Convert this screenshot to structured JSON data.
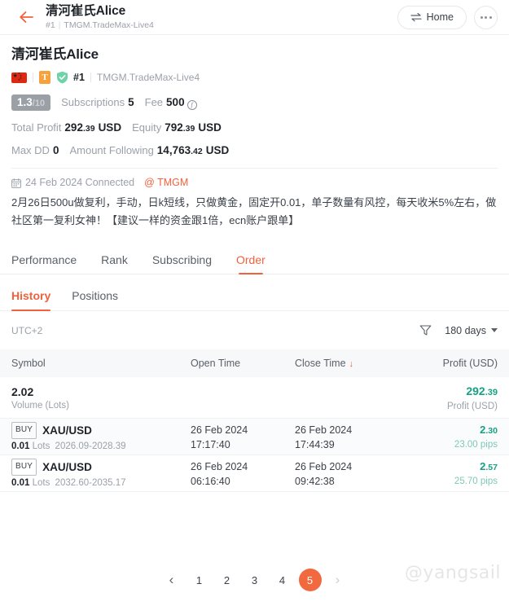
{
  "topbar": {
    "back_icon": "arrow-left-icon",
    "title": "清河崔氏Alice",
    "rank": "#1",
    "separator": "|",
    "account": "TMGM.TradeMax-Live4",
    "home_label": "Home",
    "home_icon": "swap-arrows-icon",
    "more_icon": "ellipsis-icon"
  },
  "profile": {
    "name": "清河崔氏Alice",
    "flag_icon": "china-flag-icon",
    "type_badge": "T",
    "verified_icon": "shield-check-icon",
    "rank": "#1",
    "account": "TMGM.TradeMax-Live4"
  },
  "stats": {
    "score": "1.3",
    "score_denom": "/10",
    "subscriptions_label": "Subscriptions",
    "subscriptions_value": "5",
    "fee_label": "Fee",
    "fee_value": "500",
    "fee_icon": "coin-icon",
    "total_profit_label": "Total Profit",
    "total_profit_int": "292",
    "total_profit_dec": ".39",
    "total_profit_currency": "USD",
    "equity_label": "Equity",
    "equity_int": "792",
    "equity_dec": ".39",
    "equity_currency": "USD",
    "max_dd_label": "Max DD",
    "max_dd_value": "0",
    "amount_following_label": "Amount Following",
    "amount_following_int": "14,763",
    "amount_following_dec": ".42",
    "amount_following_currency": "USD"
  },
  "meta": {
    "calendar_icon": "calendar-icon",
    "connected_text": "24 Feb 2024 Connected",
    "broker": "@ TMGM",
    "description": "2月26日500u做复利，手动，日k短线，只做黄金，固定开0.01，单子数量有风控，每天收米5%左右，做社区第一复利女神！【建议一样的资金跟1倍，ecn账户跟单】"
  },
  "tabs_primary": [
    {
      "label": "Performance",
      "active": false
    },
    {
      "label": "Rank",
      "active": false
    },
    {
      "label": "Subscribing",
      "active": false
    },
    {
      "label": "Order",
      "active": true
    }
  ],
  "tabs_secondary": [
    {
      "label": "History",
      "active": true
    },
    {
      "label": "Positions",
      "active": false
    }
  ],
  "filter": {
    "timezone": "UTC+2",
    "funnel_icon": "filter-funnel-icon",
    "period": "180 days",
    "caret_icon": "chevron-down-icon"
  },
  "table": {
    "headers": {
      "symbol": "Symbol",
      "open_time": "Open Time",
      "close_time": "Close Time",
      "sort_icon": "arrow-down-icon",
      "profit": "Profit (USD)"
    },
    "summary": {
      "volume_value": "2.02",
      "volume_label": "Volume (Lots)",
      "profit_int": "292",
      "profit_dec": ".39",
      "profit_label": "Profit (USD)"
    },
    "rows": [
      {
        "side": "BUY",
        "symbol": "XAU/USD",
        "lots": "0.01",
        "lots_label": "Lots",
        "price_range": "2026.09-2028.39",
        "open_date": "26 Feb 2024",
        "open_time": "17:17:40",
        "close_date": "26 Feb 2024",
        "close_time": "17:44:39",
        "profit_int": "2",
        "profit_dec": ".30",
        "pips": "23.00 pips"
      },
      {
        "side": "BUY",
        "symbol": "XAU/USD",
        "lots": "0.01",
        "lots_label": "Lots",
        "price_range": "2032.60-2035.17",
        "open_date": "26 Feb 2024",
        "open_time": "06:16:40",
        "close_date": "26 Feb 2024",
        "close_time": "09:42:38",
        "profit_int": "2",
        "profit_dec": ".57",
        "pips": "25.70 pips"
      }
    ]
  },
  "pagination": {
    "prev_icon": "chevron-left-icon",
    "next_icon": "chevron-right-icon",
    "pages": [
      "1",
      "2",
      "3",
      "4",
      "5"
    ],
    "current": "5"
  },
  "watermark": {
    "text": "@yangsail"
  },
  "colors": {
    "accent": "#f2603c",
    "profit_green": "#16a085",
    "muted": "#9ba1a9",
    "text": "#1f2329"
  }
}
